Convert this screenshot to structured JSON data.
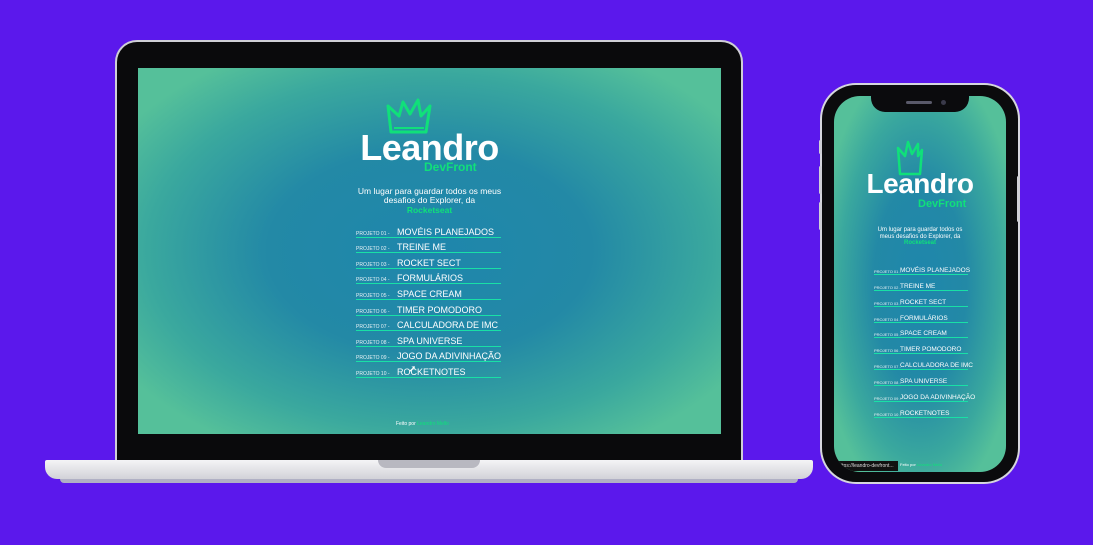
{
  "site": {
    "brand": "Leandro",
    "brand_sub": "DevFront",
    "tagline": "Um lugar para guardar todos os meus desafios do Explorer, da",
    "tagline_highlight": "Rocketseat",
    "projects": [
      {
        "num": "PROJETO 01 -",
        "name": "MOVÉIS PLANEJADOS"
      },
      {
        "num": "PROJETO 02 -",
        "name": "TREINE ME"
      },
      {
        "num": "PROJETO 03 -",
        "name": "ROCKET SECT"
      },
      {
        "num": "PROJETO 04 -",
        "name": "FORMULÁRIOS"
      },
      {
        "num": "PROJETO 05 -",
        "name": "SPACE CREAM"
      },
      {
        "num": "PROJETO 06 -",
        "name": "TIMER POMODORO"
      },
      {
        "num": "PROJETO 07 -",
        "name": "CALCULADORA DE IMC"
      },
      {
        "num": "PROJETO 08 -",
        "name": "SPA UNIVERSE"
      },
      {
        "num": "PROJETO 09 -",
        "name": "JOGO DA ADIVINHAÇÃO"
      },
      {
        "num": "PROJETO 10 -",
        "name": "ROCKETNOTES"
      }
    ],
    "footer_prefix": "Feito por",
    "footer_author": "Leandro Mello"
  },
  "phone_site": {
    "brand": "Leandro",
    "brand_sub": "DevFront",
    "tagline": "Um lugar para guardar todos os meus desafios do Explorer, da",
    "tagline_highlight": "Rocketseat",
    "projects": [
      {
        "num": "PROJETO 01 -",
        "name": "MOVÉIS PLANEJADOS"
      },
      {
        "num": "PROJETO 02 -",
        "name": "TREINE ME"
      },
      {
        "num": "PROJETO 03 -",
        "name": "ROCKET SECT"
      },
      {
        "num": "PROJETO 04 -",
        "name": "FORMULÁRIOS"
      },
      {
        "num": "PROJETO 05 -",
        "name": "SPACE CREAM"
      },
      {
        "num": "PROJETO 06 -",
        "name": "TIMER POMODORO"
      },
      {
        "num": "PROJETO 07 -",
        "name": "CALCULADORA DE IMC"
      },
      {
        "num": "PROJETO 08 -",
        "name": "SPA UNIVERSE"
      },
      {
        "num": "PROJETO 09 -",
        "name": "JOGO DA ADIVINHAÇÃO"
      },
      {
        "num": "PROJETO 10 -",
        "name": "ROCKETNOTES"
      }
    ],
    "footer_prefix": "Feito por",
    "footer_author": "Leandro Mello",
    "tooltip": "https://leandro-devfront..."
  },
  "colors": {
    "background": "#5b18ec",
    "accent_green": "#10e07a",
    "screen_center": "#1e86ac",
    "screen_edge": "#55c09a"
  },
  "icons": {
    "logo": "crown-icon",
    "cursor": "mouse-pointer-icon"
  }
}
